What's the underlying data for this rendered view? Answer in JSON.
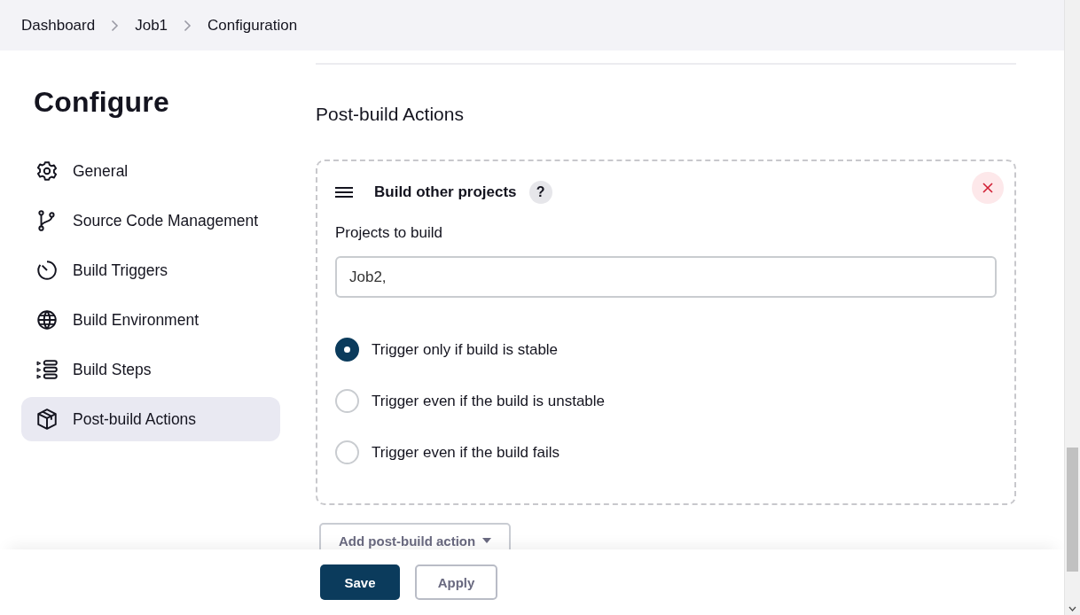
{
  "breadcrumbs": [
    "Dashboard",
    "Job1",
    "Configuration"
  ],
  "sidebar": {
    "title": "Configure",
    "items": [
      {
        "label": "General",
        "selected": false
      },
      {
        "label": "Source Code Management",
        "selected": false
      },
      {
        "label": "Build Triggers",
        "selected": false
      },
      {
        "label": "Build Environment",
        "selected": false
      },
      {
        "label": "Build Steps",
        "selected": false
      },
      {
        "label": "Post-build Actions",
        "selected": true
      }
    ]
  },
  "section": {
    "title": "Post-build Actions",
    "action": {
      "title": "Build other projects",
      "help": "?",
      "field": {
        "label": "Projects to build",
        "value": "Job2,"
      },
      "options": [
        {
          "label": "Trigger only if build is stable",
          "selected": true
        },
        {
          "label": "Trigger even if the build is unstable",
          "selected": false
        },
        {
          "label": "Trigger even if the build fails",
          "selected": false
        }
      ]
    },
    "add_button": "Add post-build action"
  },
  "footer": {
    "buttons": [
      {
        "label": "Save",
        "kind": "primary"
      },
      {
        "label": "Apply",
        "kind": "secondary"
      }
    ]
  }
}
